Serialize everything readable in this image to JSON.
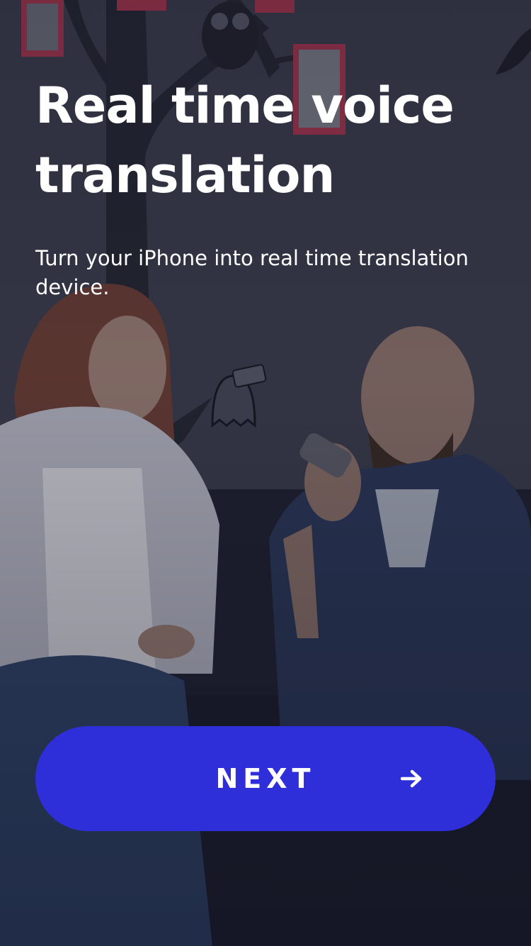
{
  "onboarding": {
    "headline": "Real time voice translation",
    "subtitle": "Turn your iPhone into real time translation device.",
    "next_button": {
      "label": "NEXT",
      "icon": "arrow-right-icon"
    }
  },
  "colors": {
    "accent": "#2e2fd8",
    "text": "#ffffff",
    "background": "#34364a"
  }
}
